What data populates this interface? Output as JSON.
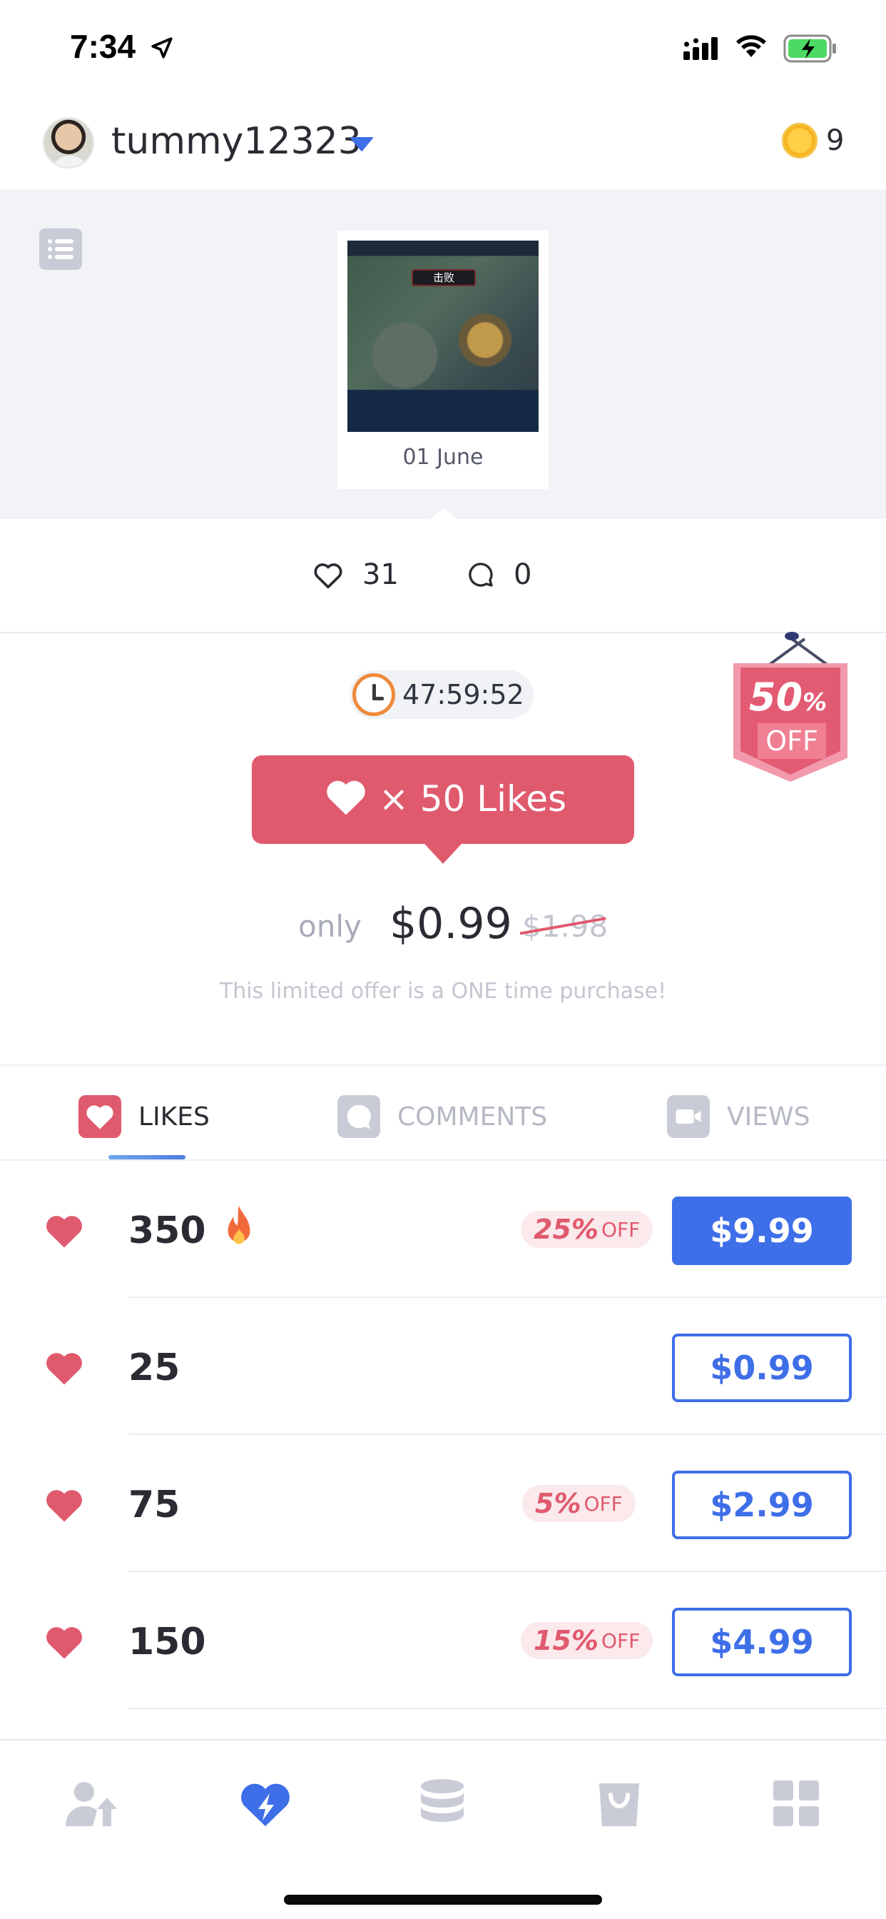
{
  "status_bar": {
    "time": "7:34"
  },
  "header": {
    "username": "tummy12323",
    "coin_count": "9"
  },
  "gallery": {
    "thumb_banner": "击败",
    "thumb_date": "01 June"
  },
  "stats": {
    "likes": "31",
    "comments": "0"
  },
  "offer": {
    "timer": "47:59:52",
    "promo_text": "× 50 Likes",
    "only_label": "only",
    "price_now": "$0.99",
    "price_old": "$1.98",
    "disclaimer": "This limited offer is a ONE time purchase!",
    "badge_pct": "50",
    "badge_pct_sign": "%",
    "badge_off": "OFF"
  },
  "tabs": [
    {
      "label": "LIKES",
      "active": true
    },
    {
      "label": "COMMENTS",
      "active": false
    },
    {
      "label": "VIEWS",
      "active": false
    }
  ],
  "packages": [
    {
      "count": "350",
      "hot": true,
      "discount_pct": "25%",
      "discount_off": "OFF",
      "price": "$9.99",
      "primary": true
    },
    {
      "count": "25",
      "hot": false,
      "discount_pct": "",
      "discount_off": "",
      "price": "$0.99",
      "primary": false
    },
    {
      "count": "75",
      "hot": false,
      "discount_pct": "5%",
      "discount_off": "OFF",
      "price": "$2.99",
      "primary": false
    },
    {
      "count": "150",
      "hot": false,
      "discount_pct": "15%",
      "discount_off": "OFF",
      "price": "$4.99",
      "primary": false
    }
  ],
  "tab_bar": {
    "items": [
      "user-follow-icon",
      "heart-bolt-icon",
      "coins-stack-icon",
      "shopping-bag-icon",
      "grid-icon"
    ],
    "active_index": 1
  },
  "colors": {
    "accent_blue": "#3e6ee8",
    "accent_red": "#e05a6e",
    "muted": "#c3c6cf"
  }
}
